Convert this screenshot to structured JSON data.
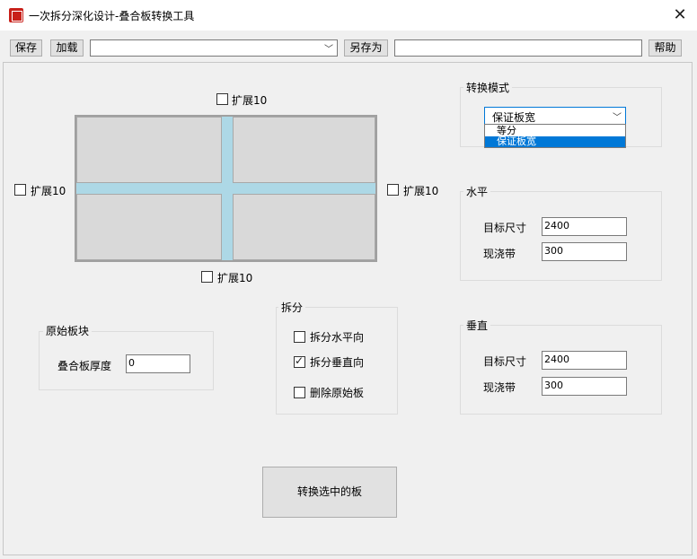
{
  "window": {
    "title": "一次拆分深化设计-叠合板转换工具",
    "close_glyph": "✕"
  },
  "toolbar": {
    "save_label": "保存",
    "load_label": "加载",
    "preset_value": "",
    "save_as_label": "另存为",
    "save_as_value": "",
    "help_label": "帮助"
  },
  "preview": {
    "extend_top_label": "扩展10",
    "extend_left_label": "扩展10",
    "extend_right_label": "扩展10",
    "extend_bottom_label": "扩展10",
    "colors": {
      "panel": "#d9d9d9",
      "gap": "#add8e6"
    }
  },
  "original_panel": {
    "group_title": "原始板块",
    "thickness_label": "叠合板厚度",
    "thickness_value": "0"
  },
  "split": {
    "group_title": "拆分",
    "split_horizontal_label": "拆分水平向",
    "split_horizontal_checked": false,
    "split_vertical_label": "拆分垂直向",
    "split_vertical_checked": true,
    "delete_original_label": "删除原始板",
    "delete_original_checked": false
  },
  "mode": {
    "group_title": "转换模式",
    "selected": "保证板宽",
    "options": [
      "等分",
      "保证板宽"
    ]
  },
  "horizontal": {
    "group_title": "水平",
    "target_size_label": "目标尺寸",
    "target_size_value": "2400",
    "cast_band_label": "现浇带",
    "cast_band_value": "300"
  },
  "vertical": {
    "group_title": "垂直",
    "target_size_label": "目标尺寸",
    "target_size_value": "2400",
    "cast_band_label": "现浇带",
    "cast_band_value": "300"
  },
  "convert_button_label": "转换选中的板"
}
